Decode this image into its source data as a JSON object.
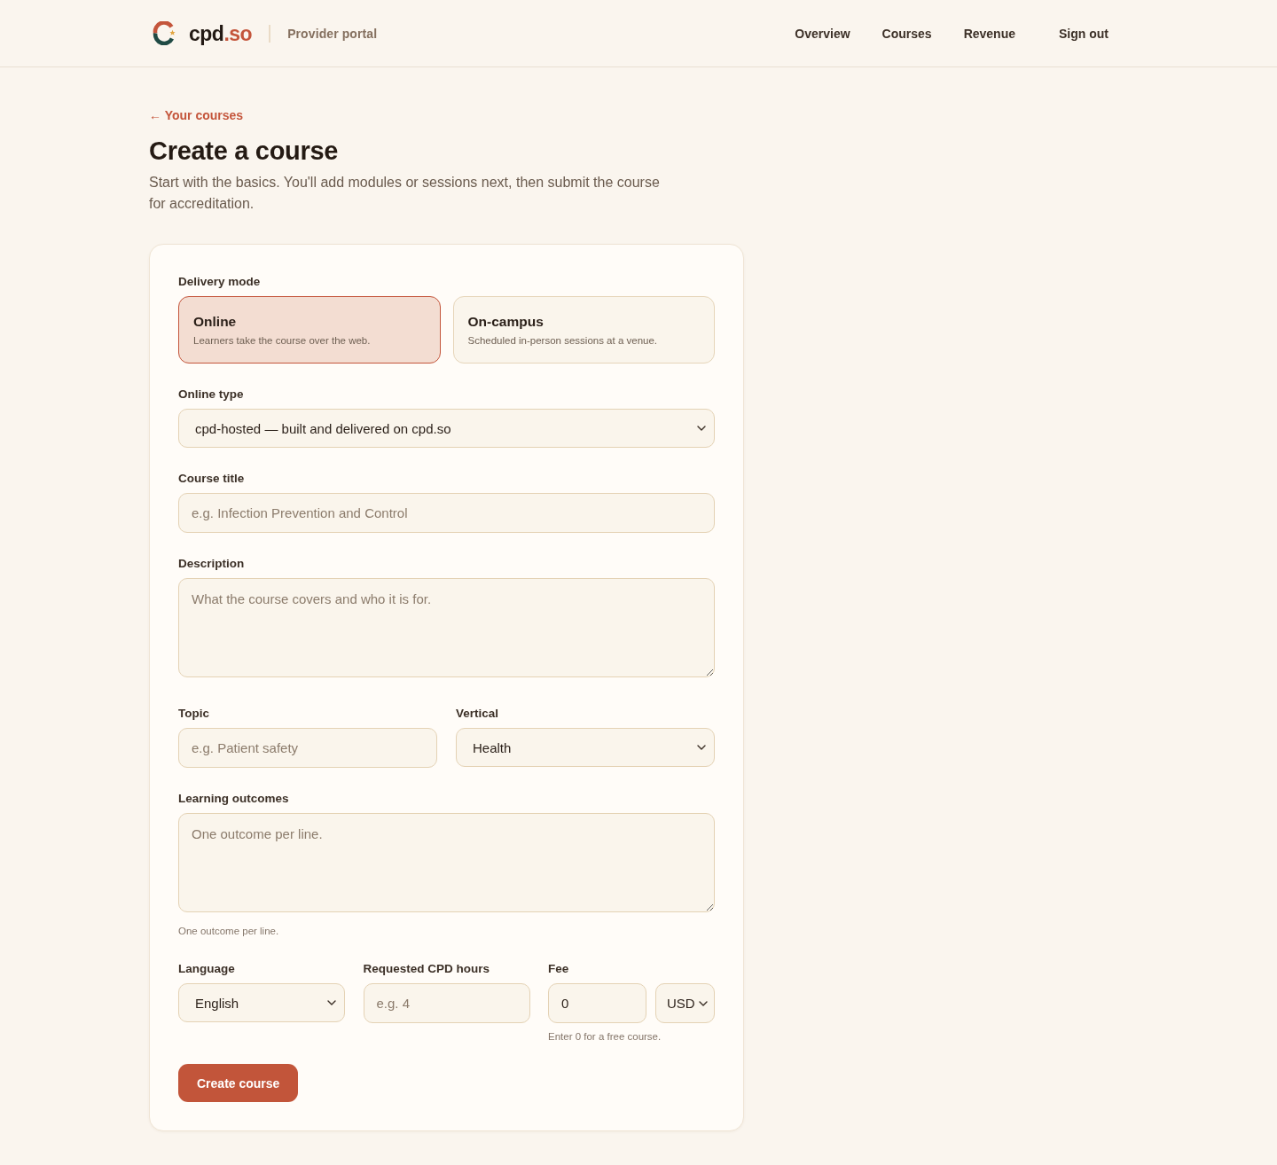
{
  "header": {
    "brand": {
      "name": "cpd",
      "suffix": ".so"
    },
    "portal": "Provider portal",
    "nav": [
      {
        "label": "Overview",
        "kind": "link"
      },
      {
        "label": "Courses",
        "kind": "link"
      },
      {
        "label": "Revenue",
        "kind": "link"
      },
      {
        "label": "Sign out",
        "kind": "action"
      }
    ]
  },
  "back_link": "← Your courses",
  "title": "Create a course",
  "intro": "Start with the basics. You'll add modules or sessions next, then submit the course for accreditation.",
  "form": {
    "sections": [
      {
        "kind": "choice",
        "label": "Delivery mode",
        "options": [
          {
            "title": "Online",
            "description": "Learners take the course over the web.",
            "selected": true
          },
          {
            "title": "On-campus",
            "description": "Scheduled in-person sessions at a venue.",
            "selected": false
          }
        ]
      },
      {
        "kind": "select",
        "label": "Online type",
        "value": "cpd-hosted — built and delivered on cpd.so"
      },
      {
        "kind": "text",
        "label": "Course title",
        "placeholder": "e.g. Infection Prevention and Control"
      },
      {
        "kind": "textarea",
        "label": "Description",
        "placeholder": "What the course covers and who it is for."
      },
      {
        "kind": "row",
        "fields": [
          {
            "kind": "text",
            "label": "Topic",
            "placeholder": "e.g. Patient safety"
          },
          {
            "kind": "select",
            "label": "Vertical",
            "value": "Health"
          }
        ]
      },
      {
        "kind": "textarea",
        "label": "Learning outcomes",
        "placeholder": "One outcome per line.",
        "hint": "One outcome per line."
      },
      {
        "kind": "row",
        "fields": [
          {
            "kind": "select",
            "label": "Language",
            "value": "English"
          },
          {
            "kind": "text",
            "label": "Requested CPD hours",
            "placeholder": "e.g. 4"
          },
          {
            "kind": "money",
            "label": "Fee",
            "value": "0",
            "currency": "USD",
            "hint": "Enter 0 for a free course."
          }
        ]
      }
    ],
    "submit": "Create course"
  }
}
